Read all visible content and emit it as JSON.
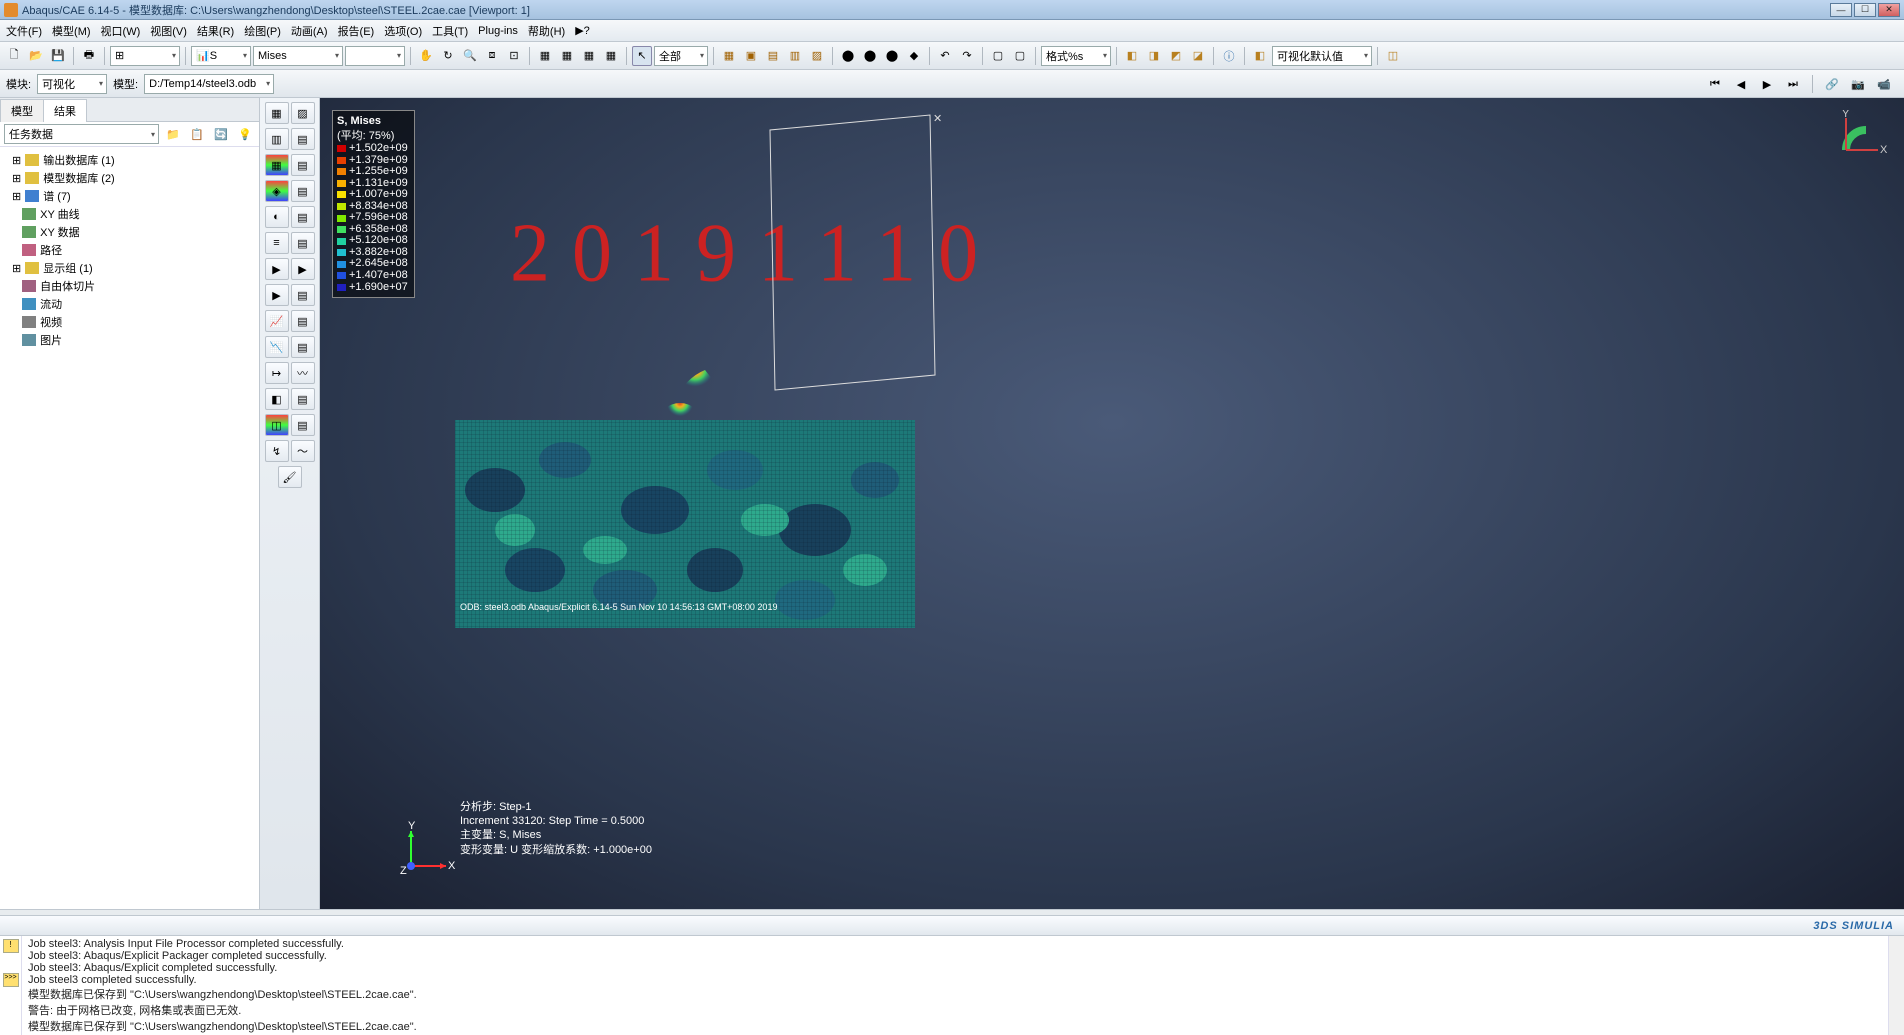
{
  "title": "Abaqus/CAE 6.14-5 - 模型数据库: C:\\Users\\wangzhendong\\Desktop\\steel\\STEEL.2cae.cae [Viewport: 1]",
  "menu": {
    "file": "文件(F)",
    "model": "模型(M)",
    "viewport": "视口(W)",
    "view": "视图(V)",
    "result": "结果(R)",
    "plot": "绘图(P)",
    "animate": "动画(A)",
    "report": "报告(E)",
    "option": "选项(O)",
    "tool": "工具(T)",
    "plugins": "Plug-ins",
    "help": "帮助(H)",
    "query": "▶?"
  },
  "tb1": {
    "field_type": "S",
    "invariant": "Mises",
    "sel": "全部",
    "lattice": "格式%s",
    "preset": "可视化默认值"
  },
  "ctx": {
    "module_lbl": "模块:",
    "module_val": "可视化",
    "model_lbl": "模型:",
    "model_val": "D:/Temp14/steel3.odb"
  },
  "leftTabs": {
    "a": "模型",
    "b": "结果"
  },
  "tree": {
    "title": "任务数据",
    "items": [
      {
        "icon": "db-yellow",
        "label": "输出数据库 (1)"
      },
      {
        "icon": "db-yellow",
        "label": "模型数据库 (2)"
      },
      {
        "icon": "wave",
        "label": "谱 (7)"
      },
      {
        "icon": "grid",
        "label": "XY 曲线"
      },
      {
        "icon": "grid",
        "label": "XY 数据"
      },
      {
        "icon": "path",
        "label": "路径"
      },
      {
        "icon": "folder",
        "label": "显示组 (1)"
      },
      {
        "icon": "slice",
        "label": "自由体切片"
      },
      {
        "icon": "flow",
        "label": "流动"
      },
      {
        "icon": "video",
        "label": "视频"
      },
      {
        "icon": "image",
        "label": "图片"
      }
    ]
  },
  "legend": {
    "title": "S, Mises",
    "subtitle": "(平均: 75%)",
    "rows": [
      {
        "c": "#d00000",
        "v": "+1.502e+09"
      },
      {
        "c": "#e84000",
        "v": "+1.379e+09"
      },
      {
        "c": "#f08000",
        "v": "+1.255e+09"
      },
      {
        "c": "#f8b000",
        "v": "+1.131e+09"
      },
      {
        "c": "#f8e000",
        "v": "+1.007e+09"
      },
      {
        "c": "#c0e800",
        "v": "+8.834e+08"
      },
      {
        "c": "#80e800",
        "v": "+7.596e+08"
      },
      {
        "c": "#40e060",
        "v": "+6.358e+08"
      },
      {
        "c": "#20d0a0",
        "v": "+5.120e+08"
      },
      {
        "c": "#20c0d0",
        "v": "+3.882e+08"
      },
      {
        "c": "#2090e0",
        "v": "+2.645e+08"
      },
      {
        "c": "#2050e0",
        "v": "+1.407e+08"
      },
      {
        "c": "#2020c0",
        "v": "+1.690e+07"
      }
    ]
  },
  "viewport_text": {
    "odb": "ODB: steel3.odb    Abaqus/Explicit 6.14-5    Sun Nov 10 14:56:13 GMT+08:00 2019",
    "step": "分析步: Step-1",
    "inc": "Increment    33120: Step Time =    0.5000",
    "var": "主变量: S, Mises",
    "def": "变形变量: U   变形缩放系数: +1.000e+00"
  },
  "handwriting": "20191110",
  "console_lines": "Job steel3: Analysis Input File Processor completed successfully.\nJob steel3: Abaqus/Explicit Packager completed successfully.\nJob steel3: Abaqus/Explicit completed successfully.\nJob steel3 completed successfully.\n模型数据库已保存到 \"C:\\Users\\wangzhendong\\Desktop\\steel\\STEEL.2cae.cae\".\n警告: 由于网格已改变, 网格集或表面已无效.\n模型数据库已保存到 \"C:\\Users\\wangzhendong\\Desktop\\steel\\STEEL.2cae.cae\".",
  "simulia": "3DS SIMULIA",
  "playback": {
    "first": "⏮",
    "prev": "◀",
    "next": "▶",
    "last": "⏭"
  }
}
